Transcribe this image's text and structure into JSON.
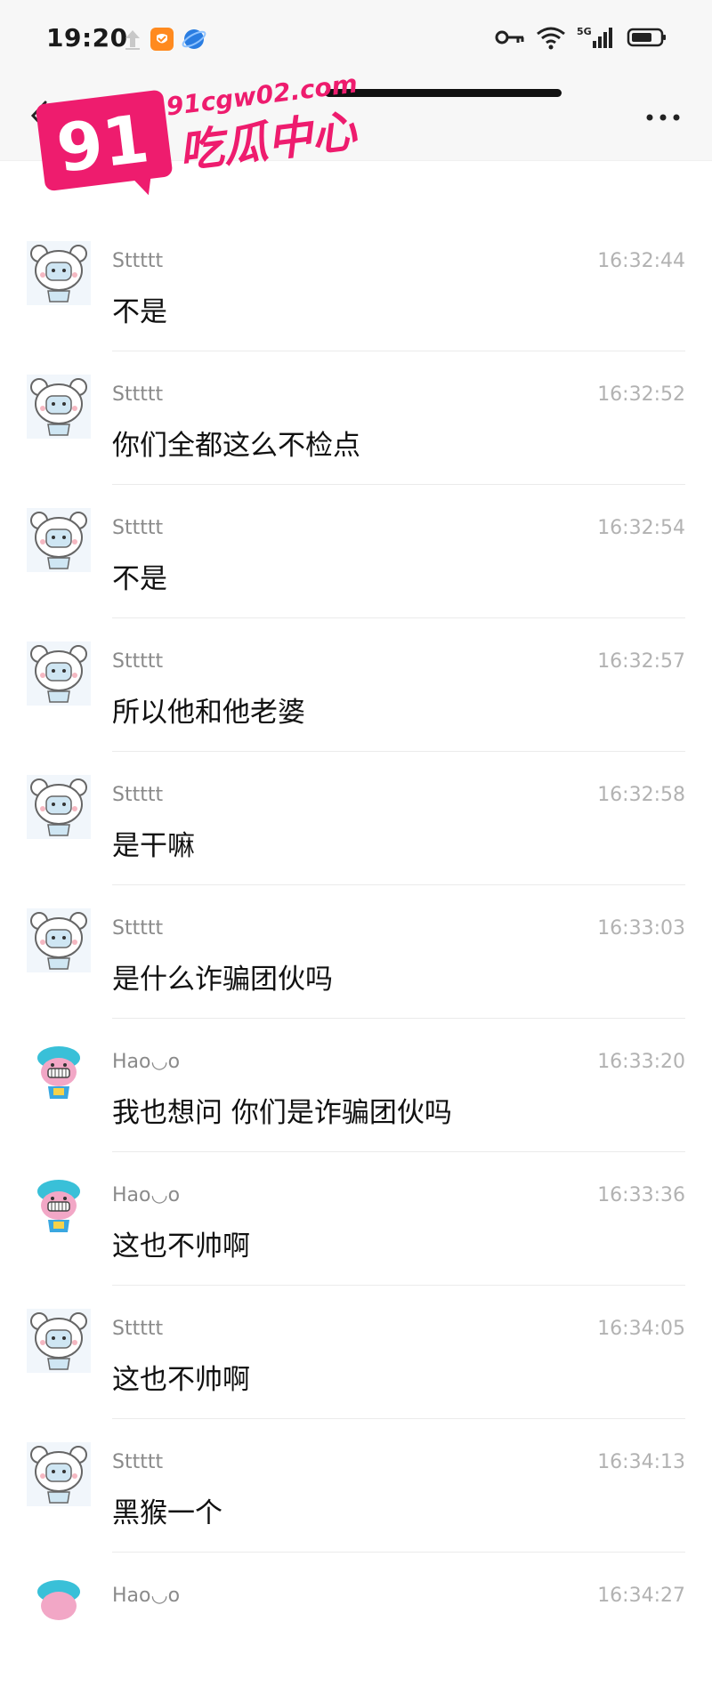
{
  "status_bar": {
    "time": "19:20",
    "network": "5G"
  },
  "watermark": {
    "number": "91",
    "site": "91cgw02.com",
    "name": "吃瓜中心"
  },
  "messages": [
    {
      "sender": "Sttttt",
      "time": "16:32:44",
      "text": "不是",
      "avatar": "bear-avatar"
    },
    {
      "sender": "Sttttt",
      "time": "16:32:52",
      "text": "你们全都这么不检点",
      "avatar": "bear-avatar"
    },
    {
      "sender": "Sttttt",
      "time": "16:32:54",
      "text": "不是",
      "avatar": "bear-avatar"
    },
    {
      "sender": "Sttttt",
      "time": "16:32:57",
      "text": "所以他和他老婆",
      "avatar": "bear-avatar"
    },
    {
      "sender": "Sttttt",
      "time": "16:32:58",
      "text": "是干嘛",
      "avatar": "bear-avatar"
    },
    {
      "sender": "Sttttt",
      "time": "16:33:03",
      "text": "是什么诈骗团伙吗",
      "avatar": "bear-avatar"
    },
    {
      "sender": "Hao◡o",
      "time": "16:33:20",
      "text": "我也想问 你们是诈骗团伙吗",
      "avatar": "cartoon-avatar"
    },
    {
      "sender": "Hao◡o",
      "time": "16:33:36",
      "text": "这也不帅啊",
      "avatar": "cartoon-avatar"
    },
    {
      "sender": "Sttttt",
      "time": "16:34:05",
      "text": "这也不帅啊",
      "avatar": "bear-avatar"
    },
    {
      "sender": "Sttttt",
      "time": "16:34:13",
      "text": "黑猴一个",
      "avatar": "bear-avatar"
    },
    {
      "sender": "Hao◡o",
      "time": "16:34:27",
      "text": "",
      "avatar": "cartoon-avatar"
    }
  ]
}
